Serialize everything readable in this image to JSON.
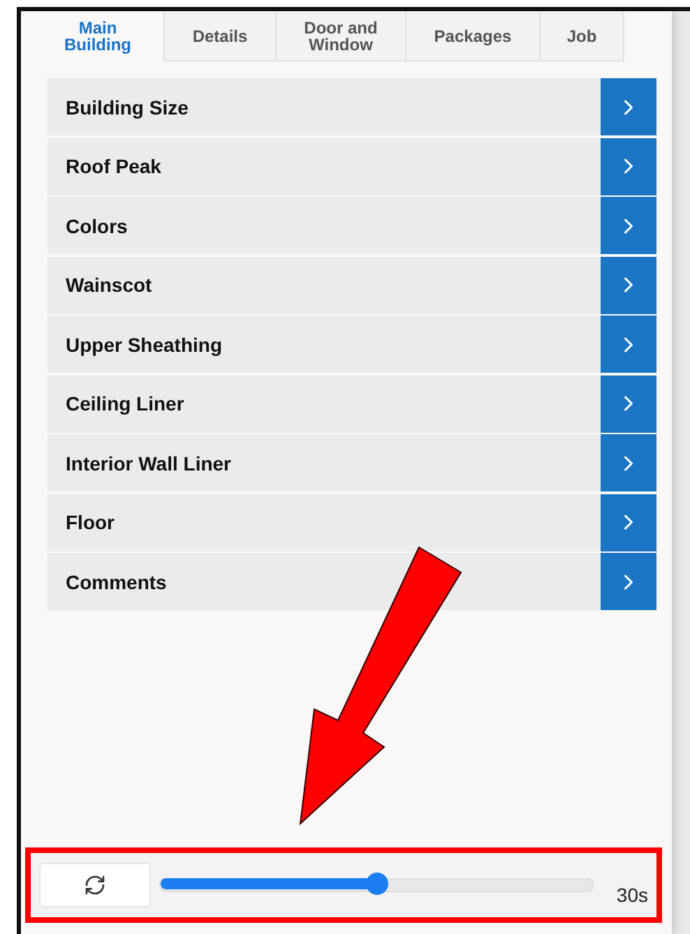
{
  "tabs": [
    {
      "label": "Main\nBuilding",
      "selected": true
    },
    {
      "label": "Details",
      "selected": false
    },
    {
      "label": "Door and\nWindow",
      "selected": false
    },
    {
      "label": "Packages",
      "selected": false
    },
    {
      "label": "Job",
      "selected": false
    }
  ],
  "sections": [
    {
      "label": "Building Size"
    },
    {
      "label": "Roof Peak"
    },
    {
      "label": "Colors"
    },
    {
      "label": "Wainscot"
    },
    {
      "label": "Upper Sheathing"
    },
    {
      "label": "Ceiling Liner"
    },
    {
      "label": "Interior Wall Liner"
    },
    {
      "label": "Floor"
    },
    {
      "label": "Comments"
    }
  ],
  "refresh": {
    "level": 0.5,
    "reading": "30s"
  }
}
